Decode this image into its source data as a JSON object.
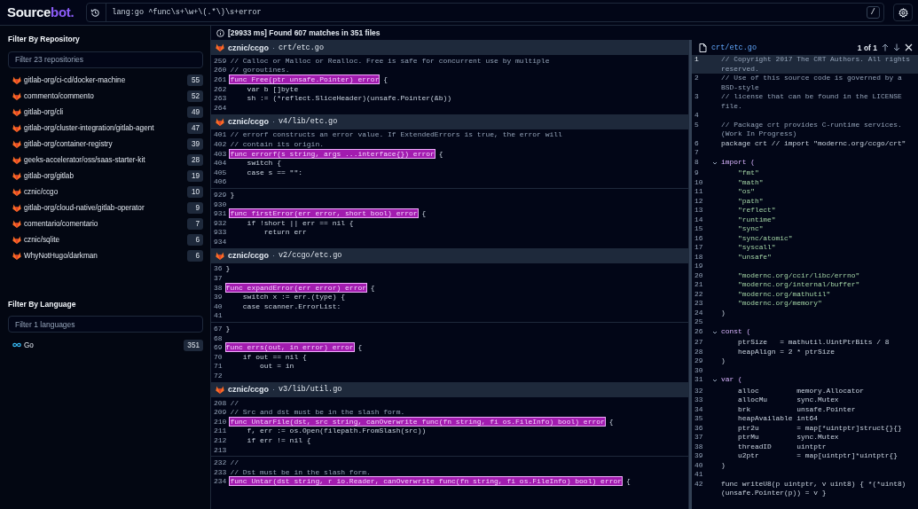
{
  "logo": {
    "text": "Source",
    "accent": "bot."
  },
  "search": {
    "query": "lang:go ^func\\s+\\w+\\(.*\\)\\s+error",
    "shortcut": "/"
  },
  "repo_filter": {
    "title": "Filter By Repository",
    "placeholder": "Filter 23 repositories",
    "items": [
      {
        "name": "gitlab-org/ci-cd/docker-machine",
        "count": "55"
      },
      {
        "name": "commento/commento",
        "count": "52"
      },
      {
        "name": "gitlab-org/cli",
        "count": "49"
      },
      {
        "name": "gitlab-org/cluster-integration/gitlab-agent",
        "count": "47"
      },
      {
        "name": "gitlab-org/container-registry",
        "count": "39"
      },
      {
        "name": "geeks-accelerator/oss/saas-starter-kit",
        "count": "28"
      },
      {
        "name": "gitlab-org/gitlab",
        "count": "19"
      },
      {
        "name": "cznic/ccgo",
        "count": "10"
      },
      {
        "name": "gitlab-org/cloud-native/gitlab-operator",
        "count": "9"
      },
      {
        "name": "comentario/comentario",
        "count": "7"
      },
      {
        "name": "cznic/sqlite",
        "count": "6"
      },
      {
        "name": "WhyNotHugo/darkman",
        "count": "6"
      }
    ]
  },
  "language_filter": {
    "title": "Filter By Language",
    "placeholder": "Filter 1 languages",
    "items": [
      {
        "name": "Go",
        "count": "351"
      }
    ]
  },
  "summary": "[29933 ms] Found 607 matches in 351 files",
  "results": [
    {
      "repo": "cznic/ccgo",
      "separator": "·",
      "path": "crt/etc.go",
      "chunks": [
        [
          {
            "num": "259",
            "kind": "comment",
            "text": "// Calloc or Malloc or Realloc. Free is safe for concurrent use by multiple"
          },
          {
            "num": "260",
            "kind": "comment",
            "text": "// goroutines."
          },
          {
            "num": "261",
            "kind": "match",
            "match": "func Free(ptr unsafe.Pointer) error",
            "text": " {"
          },
          {
            "num": "262",
            "kind": "code",
            "text": "    var b []byte"
          },
          {
            "num": "263",
            "kind": "code",
            "text": "    sh := (*reflect.SliceHeader)(unsafe.Pointer(&b))"
          },
          {
            "num": "264",
            "kind": "code"
          }
        ]
      ]
    },
    {
      "repo": "cznic/ccgo",
      "separator": "·",
      "path": "v4/lib/etc.go",
      "chunks": [
        [
          {
            "num": "401",
            "kind": "comment",
            "text": "// errorf constructs an error value. If ExtendedErrors is true, the error will"
          },
          {
            "num": "402",
            "kind": "comment",
            "text": "// contain its origin."
          },
          {
            "num": "403",
            "kind": "match",
            "match": "func errorf(s string, args ...interface{}) error",
            "text": " {"
          },
          {
            "num": "404",
            "kind": "code",
            "text": "    switch {"
          },
          {
            "num": "405",
            "kind": "code",
            "text": "    case s == \"\":"
          },
          {
            "num": "406",
            "kind": "code"
          }
        ],
        [
          {
            "num": "929",
            "kind": "code",
            "text": "}"
          },
          {
            "num": "930",
            "kind": "code"
          },
          {
            "num": "931",
            "kind": "match",
            "match": "func firstError(err error, short bool) error",
            "text": " {"
          },
          {
            "num": "932",
            "kind": "code",
            "text": "    if !short || err == nil {"
          },
          {
            "num": "933",
            "kind": "code",
            "text": "        return err"
          },
          {
            "num": "934",
            "kind": "code"
          }
        ]
      ]
    },
    {
      "repo": "cznic/ccgo",
      "separator": "·",
      "path": "v2/ccgo/etc.go",
      "chunks": [
        [
          {
            "num": "36",
            "kind": "code",
            "text": "}"
          },
          {
            "num": "37",
            "kind": "code"
          },
          {
            "num": "38",
            "kind": "match",
            "match": "func expandError(err error) error",
            "text": " {"
          },
          {
            "num": "39",
            "kind": "code",
            "text": "    switch x := err.(type) {"
          },
          {
            "num": "40",
            "kind": "code",
            "text": "    case scanner.ErrorList:"
          },
          {
            "num": "41",
            "kind": "code"
          }
        ],
        [
          {
            "num": "67",
            "kind": "code",
            "text": "}"
          },
          {
            "num": "68",
            "kind": "code"
          },
          {
            "num": "69",
            "kind": "match",
            "match": "func errs(out, in error) error",
            "text": " {"
          },
          {
            "num": "70",
            "kind": "code",
            "text": "    if out == nil {"
          },
          {
            "num": "71",
            "kind": "code",
            "text": "        out = in"
          },
          {
            "num": "72",
            "kind": "code"
          }
        ]
      ]
    },
    {
      "repo": "cznic/ccgo",
      "separator": "·",
      "path": "v3/lib/util.go",
      "chunks": [
        [
          {
            "num": "208",
            "kind": "comment",
            "text": "//"
          },
          {
            "num": "209",
            "kind": "comment",
            "text": "// Src and dst must be in the slash form."
          },
          {
            "num": "210",
            "kind": "match",
            "match": "func UntarFile(dst, src string, canOverwrite func(fn string, fi os.FileInfo) bool) error",
            "text": " {"
          },
          {
            "num": "211",
            "kind": "code",
            "text": "    f, err := os.Open(filepath.FromSlash(src))"
          },
          {
            "num": "212",
            "kind": "code",
            "text": "    if err != nil {"
          },
          {
            "num": "213",
            "kind": "code"
          }
        ],
        [
          {
            "num": "232",
            "kind": "comment",
            "text": "//"
          },
          {
            "num": "233",
            "kind": "comment",
            "text": "// Dst must be in the slash form."
          },
          {
            "num": "234",
            "kind": "match",
            "match": "func Untar(dst string, r io.Reader, canOverwrite func(fn string, fi os.FileInfo) bool) error",
            "text": " {"
          }
        ]
      ]
    }
  ],
  "preview": {
    "path": "crt/etc.go",
    "position": "1 of 1",
    "lines": [
      {
        "num": "1",
        "selected": true,
        "kind": "comment",
        "text": "// Copyright 2017 The CRT Authors. All rights reserved."
      },
      {
        "num": "2",
        "selected": false,
        "kind": "comment",
        "text": "// Use of this source code is governed by a BSD-style"
      },
      {
        "num": "3",
        "selected": false,
        "kind": "comment",
        "text": "// license that can be found in the LICENSE file."
      },
      {
        "num": "4",
        "selected": false,
        "kind": "code"
      },
      {
        "num": "5",
        "selected": false,
        "kind": "comment",
        "text": "// Package crt provides C-runtime services. (Work In Progress)"
      },
      {
        "num": "6",
        "selected": false,
        "kind": "code",
        "text": "package crt // import \"modernc.org/ccgo/crt\""
      },
      {
        "num": "7",
        "selected": false,
        "kind": "code"
      },
      {
        "num": "8",
        "selected": false,
        "kind": "fold",
        "text": "import ("
      },
      {
        "num": "9",
        "selected": false,
        "kind": "string",
        "text": "    \"fmt\""
      },
      {
        "num": "10",
        "selected": false,
        "kind": "string",
        "text": "    \"math\""
      },
      {
        "num": "11",
        "selected": false,
        "kind": "string",
        "text": "    \"os\""
      },
      {
        "num": "12",
        "selected": false,
        "kind": "string",
        "text": "    \"path\""
      },
      {
        "num": "13",
        "selected": false,
        "kind": "string",
        "text": "    \"reflect\""
      },
      {
        "num": "14",
        "selected": false,
        "kind": "string",
        "text": "    \"runtime\""
      },
      {
        "num": "15",
        "selected": false,
        "kind": "string",
        "text": "    \"sync\""
      },
      {
        "num": "16",
        "selected": false,
        "kind": "string",
        "text": "    \"sync/atomic\""
      },
      {
        "num": "17",
        "selected": false,
        "kind": "string",
        "text": "    \"syscall\""
      },
      {
        "num": "18",
        "selected": false,
        "kind": "string",
        "text": "    \"unsafe\""
      },
      {
        "num": "19",
        "selected": false,
        "kind": "code"
      },
      {
        "num": "20",
        "selected": false,
        "kind": "string",
        "text": "    \"modernc.org/ccir/libc/errno\""
      },
      {
        "num": "21",
        "selected": false,
        "kind": "string",
        "text": "    \"modernc.org/internal/buffer\""
      },
      {
        "num": "22",
        "selected": false,
        "kind": "string",
        "text": "    \"modernc.org/mathutil\""
      },
      {
        "num": "23",
        "selected": false,
        "kind": "string",
        "text": "    \"modernc.org/memory\""
      },
      {
        "num": "24",
        "selected": false,
        "kind": "code",
        "text": ")"
      },
      {
        "num": "25",
        "selected": false,
        "kind": "code"
      },
      {
        "num": "26",
        "selected": false,
        "kind": "fold",
        "text": "const ("
      },
      {
        "num": "27",
        "selected": false,
        "kind": "code",
        "text": "    ptrSize   = mathutil.UintPtrBits / 8"
      },
      {
        "num": "28",
        "selected": false,
        "kind": "code",
        "text": "    heapAlign = 2 * ptrSize"
      },
      {
        "num": "29",
        "selected": false,
        "kind": "code",
        "text": ")"
      },
      {
        "num": "30",
        "selected": false,
        "kind": "code"
      },
      {
        "num": "31",
        "selected": false,
        "kind": "fold",
        "text": "var ("
      },
      {
        "num": "32",
        "selected": false,
        "kind": "code",
        "text": "    alloc         memory.Allocator"
      },
      {
        "num": "33",
        "selected": false,
        "kind": "code",
        "text": "    allocMu       sync.Mutex"
      },
      {
        "num": "34",
        "selected": false,
        "kind": "code",
        "text": "    brk           unsafe.Pointer"
      },
      {
        "num": "35",
        "selected": false,
        "kind": "code",
        "text": "    heapAvailable int64"
      },
      {
        "num": "36",
        "selected": false,
        "kind": "code",
        "text": "    ptr2u         = map[*uintptr]struct{}{}"
      },
      {
        "num": "37",
        "selected": false,
        "kind": "code",
        "text": "    ptrMu         sync.Mutex"
      },
      {
        "num": "38",
        "selected": false,
        "kind": "code",
        "text": "    threadID      uintptr"
      },
      {
        "num": "39",
        "selected": false,
        "kind": "code",
        "text": "    u2ptr         = map[uintptr]*uintptr{}"
      },
      {
        "num": "40",
        "selected": false,
        "kind": "code",
        "text": ")"
      },
      {
        "num": "41",
        "selected": false,
        "kind": "code"
      },
      {
        "num": "42",
        "selected": false,
        "kind": "code",
        "text": "func writeU8(p uintptr, v uint8) { *(*uint8)(unsafe.Pointer(p)) = v }"
      }
    ]
  }
}
